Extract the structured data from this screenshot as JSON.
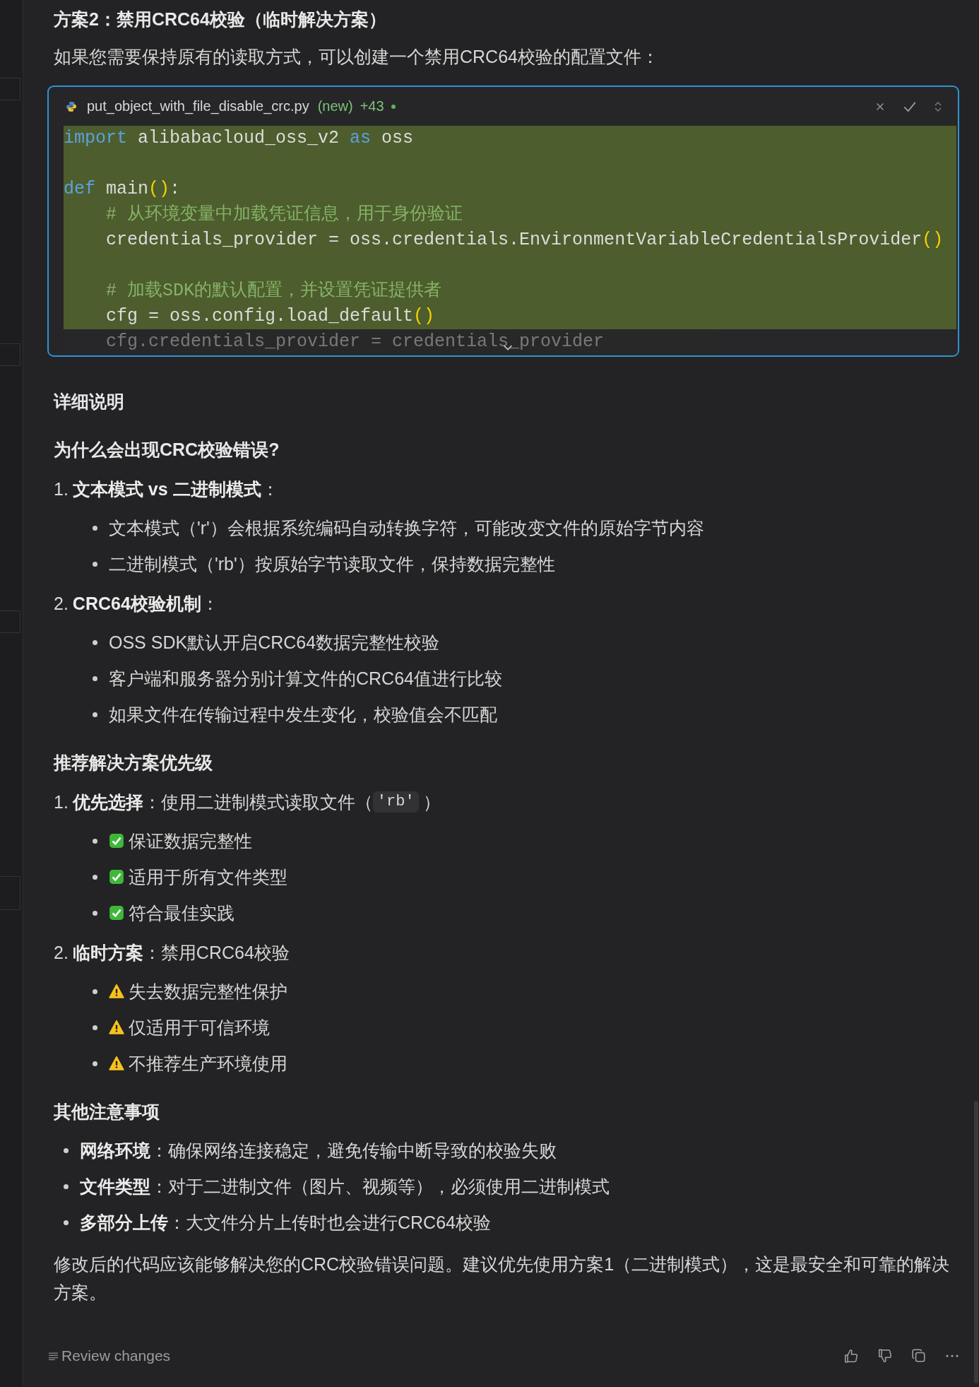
{
  "heading": "方案2：禁用CRC64校验（临时解决方案）",
  "intro": "如果您需要保持原有的读取方式，可以创建一个禁用CRC64校验的配置文件：",
  "code_block": {
    "file_name": "put_object_with_file_disable_crc.py",
    "status": "(new)",
    "additions": "+43",
    "collapsed": true,
    "lines": [
      {
        "added": true,
        "tokens": [
          {
            "kind": "keyword",
            "text": "import"
          },
          {
            "kind": "plain",
            "text": " alibabacloud_oss_v2 "
          },
          {
            "kind": "keyword",
            "text": "as"
          },
          {
            "kind": "plain",
            "text": " oss"
          }
        ]
      },
      {
        "added": true
      },
      {
        "added": true,
        "tokens": [
          {
            "kind": "keyword",
            "text": "def"
          },
          {
            "kind": "plain",
            "text": " main"
          },
          {
            "kind": "paren",
            "text": "()"
          },
          {
            "kind": "plain",
            "text": ":"
          }
        ]
      },
      {
        "added": true,
        "tokens": [
          {
            "kind": "comment",
            "text": "    # 从环境变量中加载凭证信息，用于身份验证"
          }
        ]
      },
      {
        "added": true,
        "tokens": [
          {
            "kind": "plain",
            "text": "    credentials_provider = oss.credentials.EnvironmentVariableCredentialsProvider"
          },
          {
            "kind": "paren",
            "text": "()"
          }
        ]
      },
      {
        "added": true
      },
      {
        "added": true,
        "tokens": [
          {
            "kind": "comment",
            "text": "    # 加载SDK的默认配置，并设置凭证提供者"
          }
        ]
      },
      {
        "added": true,
        "tokens": [
          {
            "kind": "plain",
            "text": "    cfg = oss.config.load_default"
          },
          {
            "kind": "paren",
            "text": "()"
          }
        ]
      },
      {
        "tokens": [
          {
            "kind": "plain",
            "text": "    cfg.credentials_provider = credentials_provider"
          }
        ]
      }
    ]
  },
  "details": [
    {
      "kind": "heading",
      "text": "详细说明"
    },
    {
      "kind": "subheading",
      "text": "为什么会出现CRC校验错误?"
    },
    {
      "kind": "numbered",
      "number": "1.",
      "text": "**文本模式 vs 二进制模式**：",
      "items": [
        {
          "text": "文本模式（'r'）会根据系统编码自动转换字符，可能改变文件的原始字节内容"
        },
        {
          "text": "二进制模式（'rb'）按原始字节读取文件，保持数据完整性"
        }
      ]
    },
    {
      "kind": "numbered",
      "number": "2.",
      "text": "**CRC64校验机制**：",
      "items": [
        {
          "text": "OSS SDK默认开启CRC64数据完整性校验"
        },
        {
          "text": "客户端和服务器分别计算文件的CRC64值进行比较"
        },
        {
          "text": "如果文件在传输过程中发生变化，校验值会不匹配"
        }
      ]
    },
    {
      "kind": "subheading",
      "text": "推荐解决方案优先级"
    },
    {
      "kind": "numbered",
      "number": "1.",
      "text": "**优先选择**：使用二进制模式读取文件（",
      "code": "'rb'",
      "suffix": "）",
      "items": [
        {
          "kind": "check",
          "text": "保证数据完整性"
        },
        {
          "kind": "check",
          "text": "适用于所有文件类型"
        },
        {
          "kind": "check",
          "text": "符合最佳实践"
        }
      ]
    },
    {
      "kind": "numbered",
      "number": "2.",
      "text": "**临时方案**：禁用CRC64校验",
      "items": [
        {
          "kind": "warning",
          "text": "失去数据完整性保护"
        },
        {
          "kind": "warning",
          "text": "仅适用于可信环境"
        },
        {
          "kind": "warning",
          "text": "不推荐生产环境使用"
        }
      ]
    },
    {
      "kind": "subheading",
      "text": "其他注意事项"
    },
    {
      "kind": "bullets",
      "items": [
        {
          "text": "**网络环境**：确保网络连接稳定，避免传输中断导致的校验失败"
        },
        {
          "text": "**文件类型**：对于二进制文件（图片、视频等），必须使用二进制模式"
        },
        {
          "text": "**多部分上传**：大文件分片上传时也会进行CRC64校验"
        }
      ]
    },
    {
      "kind": "paragraph",
      "text": "修改后的代码应该能够解决您的CRC校验错误问题。建议优先使用方案1（二进制模式），这是最安全和可靠的解决方案。"
    }
  ],
  "footer": {
    "review_button": "Review changes"
  }
}
